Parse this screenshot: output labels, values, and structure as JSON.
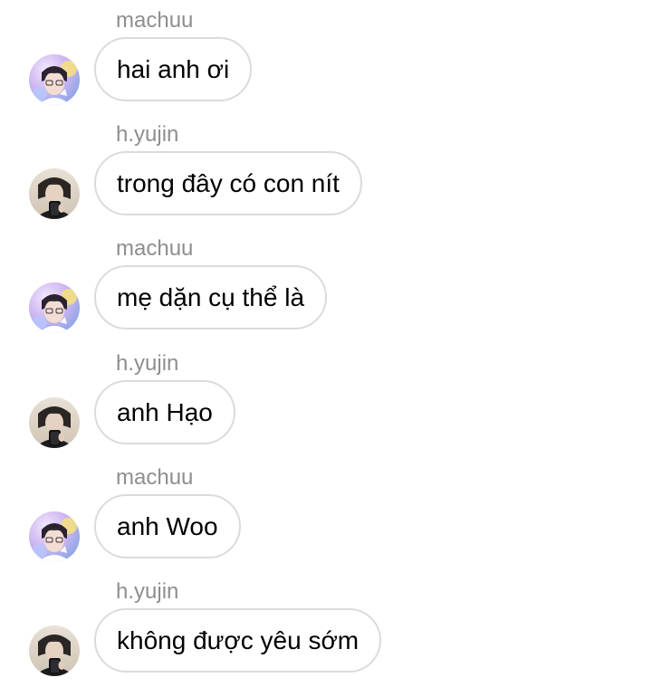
{
  "messages": [
    {
      "sender": "machuu",
      "text": "hai anh ơi",
      "avatar": "machuu-avatar"
    },
    {
      "sender": "h.yujin",
      "text": "trong đây có con nít",
      "avatar": "hyujin-avatar"
    },
    {
      "sender": "machuu",
      "text": "mẹ dặn cụ thể là",
      "avatar": "machuu-avatar"
    },
    {
      "sender": "h.yujin",
      "text": "anh Hạo",
      "avatar": "hyujin-avatar"
    },
    {
      "sender": "machuu",
      "text": "anh Woo",
      "avatar": "machuu-avatar"
    },
    {
      "sender": "h.yujin",
      "text": "không được yêu sớm",
      "avatar": "hyujin-avatar"
    }
  ],
  "colors": {
    "background": "#ffffff",
    "sender_name": "#8e8e8e",
    "bubble_border": "#dbdbdb",
    "message_text": "#000000"
  }
}
